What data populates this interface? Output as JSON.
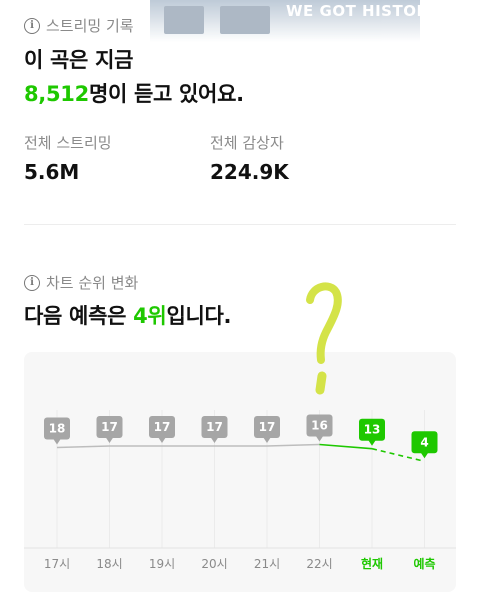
{
  "streaming": {
    "section_label": "스트리밍 기록",
    "headline_line1": "이 곡은 지금",
    "listener_count": "8,512",
    "headline_suffix": "명이 듣고 있어요.",
    "total_streaming_label": "전체 스트리밍",
    "total_streaming_value": "5.6M",
    "total_listeners_label": "전체 감상자",
    "total_listeners_value": "224.9K"
  },
  "chart": {
    "section_label": "차트 순위 변화",
    "prediction_prefix": "다음 예측은 ",
    "prediction_rank": "4위",
    "prediction_suffix": "입니다."
  },
  "banner": {
    "text": "WE GOT HISTORY"
  },
  "colors": {
    "accent": "#1ec800",
    "gray_marker": "#a6a6a6",
    "muted": "#8a8a8a"
  },
  "chart_data": {
    "type": "line",
    "categories": [
      "17시",
      "18시",
      "19시",
      "20시",
      "21시",
      "22시",
      "현재",
      "예측"
    ],
    "values": [
      18,
      17,
      17,
      17,
      17,
      16,
      13,
      4
    ],
    "highlight": [
      "현재",
      "예측"
    ],
    "dashed_from": "현재",
    "annotation": "?"
  }
}
